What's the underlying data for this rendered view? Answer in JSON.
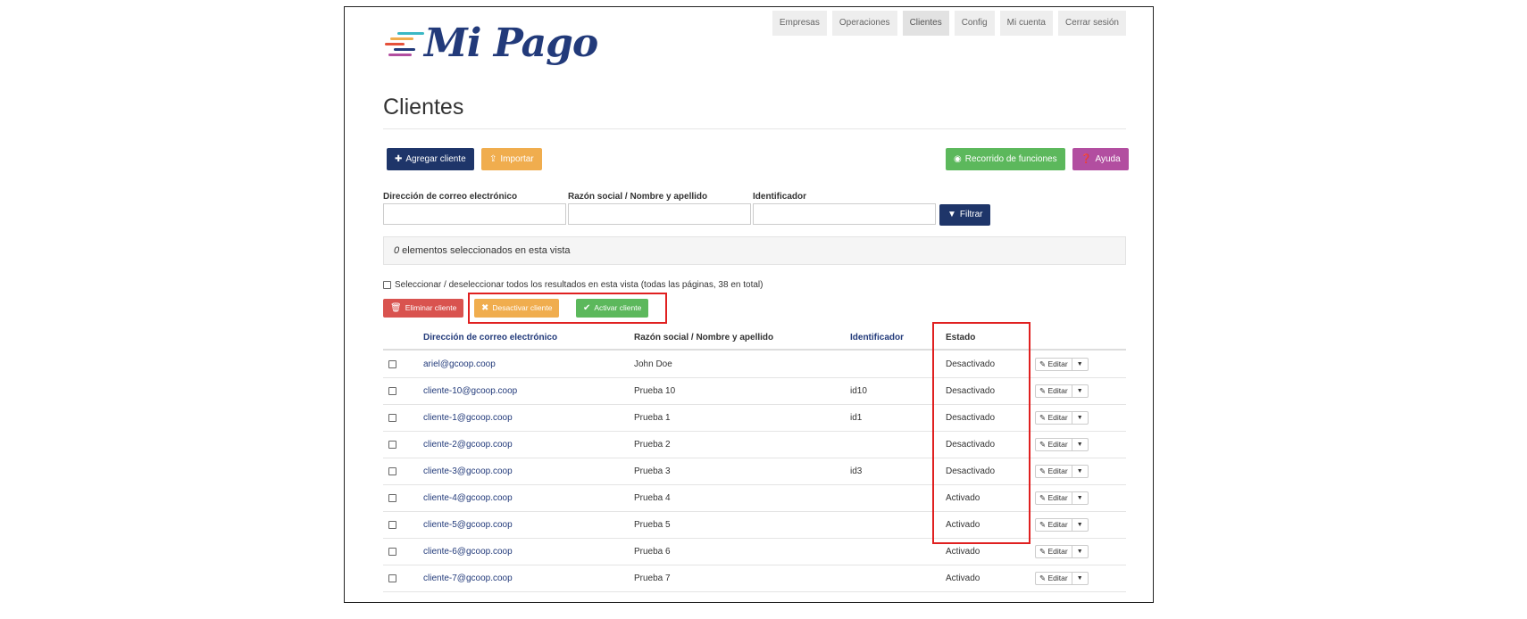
{
  "brand": {
    "name": "Mi Pago",
    "stripe_colors": [
      "#e5513a",
      "#f0ad4e",
      "#3bb8c4",
      "#223a7a",
      "#b24ea0"
    ]
  },
  "nav": [
    {
      "label": "Empresas"
    },
    {
      "label": "Operaciones"
    },
    {
      "label": "Clientes"
    },
    {
      "label": "Config"
    },
    {
      "label": "Mi cuenta"
    },
    {
      "label": "Cerrar sesión"
    }
  ],
  "page": {
    "title": "Clientes"
  },
  "toolbar": {
    "add_label": "Agregar cliente",
    "import_label": "Importar",
    "tour_label": "Recorrido de funciones",
    "help_label": "Ayuda"
  },
  "filters": {
    "email_label": "Dirección de correo electrónico",
    "email_value": "",
    "name_label": "Razón social / Nombre y apellido",
    "name_value": "",
    "id_label": "Identificador",
    "id_value": "",
    "filter_label": "Filtrar"
  },
  "selection": {
    "count": "0",
    "text": " elementos seleccionados en esta vista",
    "select_all_label": "Seleccionar / deseleccionar todos los resultados en esta vista (todas las páginas, 38 en total)"
  },
  "actions": {
    "delete_label": "Eliminar cliente",
    "deactivate_label": "Desactivar cliente",
    "activate_label": "Activar cliente"
  },
  "table": {
    "headers": {
      "email": "Dirección de correo electrónico",
      "name": "Razón social / Nombre y apellido",
      "id": "Identificador",
      "state": "Estado"
    },
    "edit_label": "Editar",
    "rows": [
      {
        "email": "ariel@gcoop.coop",
        "name": "John Doe",
        "id": "",
        "state": "Desactivado"
      },
      {
        "email": "cliente-10@gcoop.coop",
        "name": "Prueba 10",
        "id": "id10",
        "state": "Desactivado"
      },
      {
        "email": "cliente-1@gcoop.coop",
        "name": "Prueba 1",
        "id": "id1",
        "state": "Desactivado"
      },
      {
        "email": "cliente-2@gcoop.coop",
        "name": "Prueba 2",
        "id": "",
        "state": "Desactivado"
      },
      {
        "email": "cliente-3@gcoop.coop",
        "name": "Prueba 3",
        "id": "id3",
        "state": "Desactivado"
      },
      {
        "email": "cliente-4@gcoop.coop",
        "name": "Prueba 4",
        "id": "",
        "state": "Activado"
      },
      {
        "email": "cliente-5@gcoop.coop",
        "name": "Prueba 5",
        "id": "",
        "state": "Activado"
      },
      {
        "email": "cliente-6@gcoop.coop",
        "name": "Prueba 6",
        "id": "",
        "state": "Activado"
      },
      {
        "email": "cliente-7@gcoop.coop",
        "name": "Prueba 7",
        "id": "",
        "state": "Activado"
      }
    ]
  },
  "icons": {
    "plus": "plus-icon",
    "import": "upload-icon",
    "globe": "globe-icon",
    "help": "question-circle-icon",
    "filter": "filter-icon",
    "trash": "trash-icon",
    "times": "times-icon",
    "check": "check-icon",
    "pencil": "pencil-icon",
    "caret": "caret-down-icon"
  },
  "colors": {
    "navy": "#1e3569",
    "orange": "#f0ad4e",
    "green": "#5cb85c",
    "purple": "#b24ea0",
    "red": "#d9534f",
    "highlight": "#e02020"
  }
}
